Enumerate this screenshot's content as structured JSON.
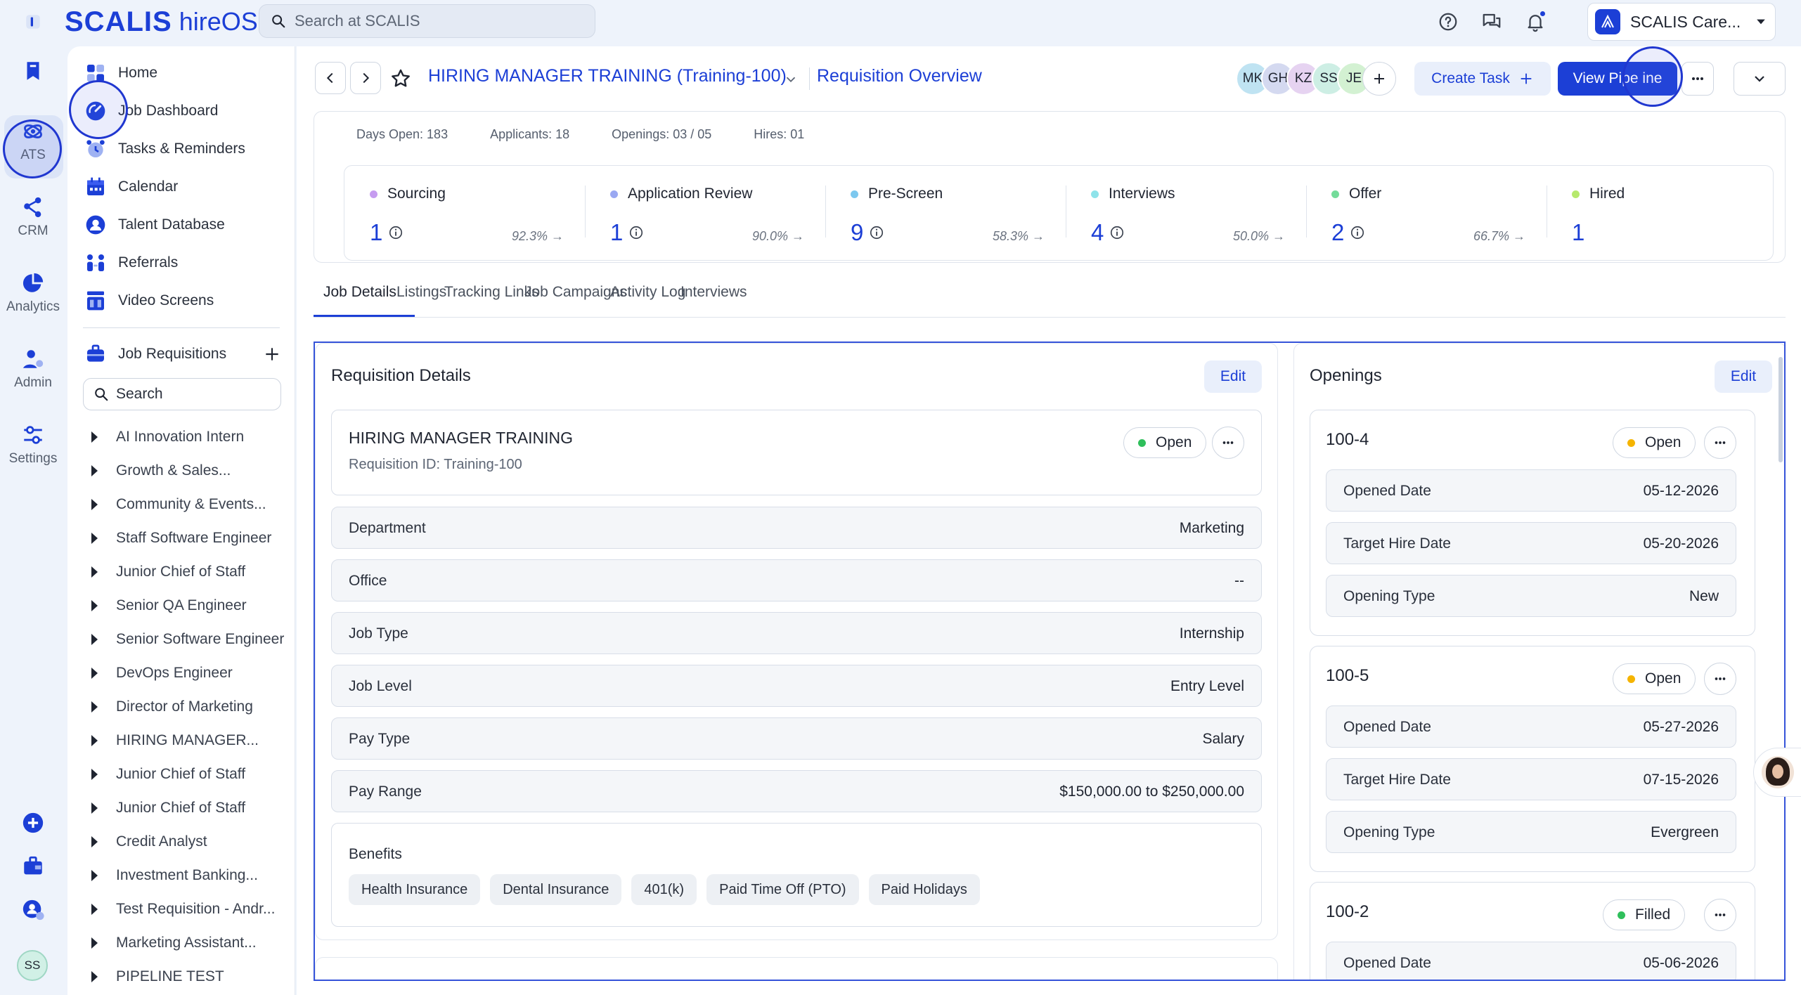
{
  "app": {
    "brand_main": "SCALIS",
    "brand_sub": "hireOS",
    "search_placeholder": "Search at SCALIS",
    "org_name": "SCALIS Care..."
  },
  "rail": {
    "items": [
      {
        "label": "",
        "icon": "bookmark-icon"
      },
      {
        "label": "ATS",
        "icon": "ats-icon"
      },
      {
        "label": "CRM",
        "icon": "crm-icon"
      },
      {
        "label": "Analytics",
        "icon": "analytics-icon"
      },
      {
        "label": "Admin",
        "icon": "admin-icon"
      },
      {
        "label": "Settings",
        "icon": "settings-icon"
      }
    ],
    "user_initials": "SS"
  },
  "sidebar": {
    "nav": [
      {
        "label": "Home"
      },
      {
        "label": "Job Dashboard"
      },
      {
        "label": "Tasks & Reminders"
      },
      {
        "label": "Calendar"
      },
      {
        "label": "Talent Database"
      },
      {
        "label": "Referrals"
      },
      {
        "label": "Video Screens"
      }
    ],
    "requisitions_label": "Job Requisitions",
    "search_placeholder": "Search",
    "requisitions": [
      "AI Innovation Intern",
      "Growth & Sales...",
      "Community & Events...",
      "Staff Software Engineer",
      "Junior Chief of Staff",
      "Senior QA Engineer",
      "Senior Software Engineer",
      "DevOps Engineer",
      "Director of Marketing",
      "HIRING MANAGER...",
      "Junior Chief of Staff",
      "Junior Chief of Staff",
      "Credit Analyst",
      "Investment Banking...",
      "Test Requisition - Andr...",
      "Marketing Assistant...",
      "PIPELINE TEST"
    ]
  },
  "header": {
    "title": "HIRING MANAGER TRAINING (Training-100)",
    "overview": "Requisition Overview",
    "avatars": [
      {
        "initials": "MK",
        "color": "#bfe3f2"
      },
      {
        "initials": "GH",
        "color": "#d4d9f0"
      },
      {
        "initials": "KZ",
        "color": "#e6d3f1"
      },
      {
        "initials": "SS",
        "color": "#cdeee4"
      },
      {
        "initials": "JE",
        "color": "#d3f1d2"
      }
    ],
    "create_task": "Create Task",
    "view_pipeline": "View Pipe ine"
  },
  "stats": {
    "days_open": "Days Open: 183",
    "applicants": "Applicants: 18",
    "openings": "Openings: 03 / 05",
    "hires": "Hires: 01"
  },
  "funnel": [
    {
      "name": "Sourcing",
      "count": "1",
      "pct": "92.3% →",
      "color": "#c69cf0"
    },
    {
      "name": "Application Review",
      "count": "1",
      "pct": "90.0% →",
      "color": "#9aa8f2"
    },
    {
      "name": "Pre-Screen",
      "count": "9",
      "pct": "58.3% →",
      "color": "#7cc8ef"
    },
    {
      "name": "Interviews",
      "count": "4",
      "pct": "50.0% →",
      "color": "#8ee3ea"
    },
    {
      "name": "Offer",
      "count": "2",
      "pct": "66.7% →",
      "color": "#74dc9a"
    },
    {
      "name": "Hired",
      "count": "1",
      "pct": "",
      "color": "#b6e96d"
    }
  ],
  "tabs": [
    "Job Details",
    "Listings",
    "Tracking Links",
    "Job Campaigns",
    "Activity Log",
    "Interviews"
  ],
  "requisition": {
    "panel_title": "Requisition Details",
    "edit": "Edit",
    "name": "HIRING MANAGER TRAINING",
    "req_id": "Requisition ID: Training-100",
    "status": "Open",
    "fields": [
      {
        "k": "Department",
        "v": "Marketing"
      },
      {
        "k": "Office",
        "v": "--"
      },
      {
        "k": "Job Type",
        "v": "Internship"
      },
      {
        "k": "Job Level",
        "v": "Entry Level"
      },
      {
        "k": "Pay Type",
        "v": "Salary"
      },
      {
        "k": "Pay Range",
        "v": "$150,000.00 to $250,000.00"
      }
    ],
    "benefits_label": "Benefits",
    "benefits": [
      "Health Insurance",
      "Dental Insurance",
      "401(k)",
      "Paid Time Off (PTO)",
      "Paid Holidays"
    ]
  },
  "openings": {
    "panel_title": "Openings",
    "edit": "Edit",
    "items": [
      {
        "id": "100-4",
        "status": "Open",
        "status_color": "#f5b400",
        "rows": [
          {
            "k": "Opened Date",
            "v": "05-12-2026"
          },
          {
            "k": "Target Hire Date",
            "v": "05-20-2026"
          },
          {
            "k": "Opening Type",
            "v": "New"
          }
        ]
      },
      {
        "id": "100-5",
        "status": "Open",
        "status_color": "#f5b400",
        "rows": [
          {
            "k": "Opened Date",
            "v": "05-27-2026"
          },
          {
            "k": "Target Hire Date",
            "v": "07-15-2026"
          },
          {
            "k": "Opening Type",
            "v": "Evergreen"
          }
        ]
      },
      {
        "id": "100-2",
        "status": "Filled",
        "status_color": "#2fbf5b",
        "rows": [
          {
            "k": "Opened Date",
            "v": "05-06-2026"
          }
        ]
      }
    ]
  }
}
